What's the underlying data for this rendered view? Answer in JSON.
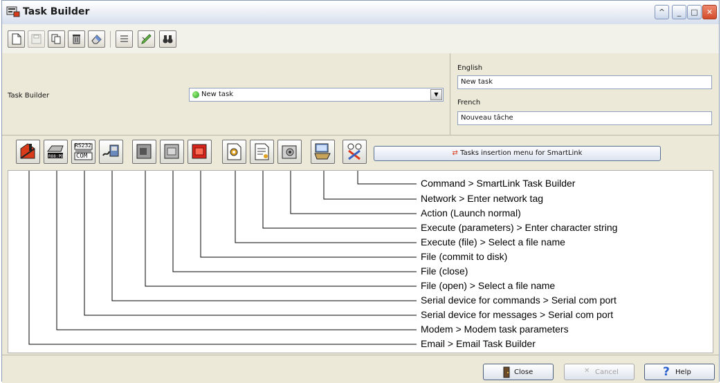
{
  "window": {
    "title": "Task Builder"
  },
  "toolbar": {
    "buttons": [
      {
        "icon": "new-document-icon"
      },
      {
        "icon": "save-icon"
      },
      {
        "icon": "copy-icon"
      },
      {
        "icon": "delete-icon"
      },
      {
        "icon": "eraser-icon"
      },
      {
        "icon": "list-icon"
      },
      {
        "icon": "check-pen-icon"
      },
      {
        "icon": "binoculars-icon"
      }
    ]
  },
  "header": {
    "label": "Task Builder",
    "combo_value": "New task"
  },
  "languages": [
    {
      "name": "English",
      "value": "New task"
    },
    {
      "name": "French",
      "value": "Nouveau tâche"
    }
  ],
  "task_toolbar": {
    "insert_button": "Tasks insertion menu for SmartLink",
    "rs232_label": "RS232",
    "com_label": "COM"
  },
  "callouts": [
    "Command > SmartLink Task Builder",
    "Network  > Enter network tag",
    "Action (Launch normal)",
    "Execute (parameters) > Enter character string",
    "Execute (file) > Select a file name",
    "File (commit to disk)",
    "File (close)",
    "File (open) > Select a file name",
    "Serial device for commands > Serial com port",
    "Serial device for messages > Serial com port",
    "Modem > Modem task parameters",
    "Email > Email Task Builder"
  ],
  "footer": {
    "close": "Close",
    "cancel": "Cancel",
    "help": "Help"
  },
  "colors": {
    "accent": "#58708f",
    "close_red": "#d24a2a",
    "ok_green": "#1e9a1e"
  }
}
